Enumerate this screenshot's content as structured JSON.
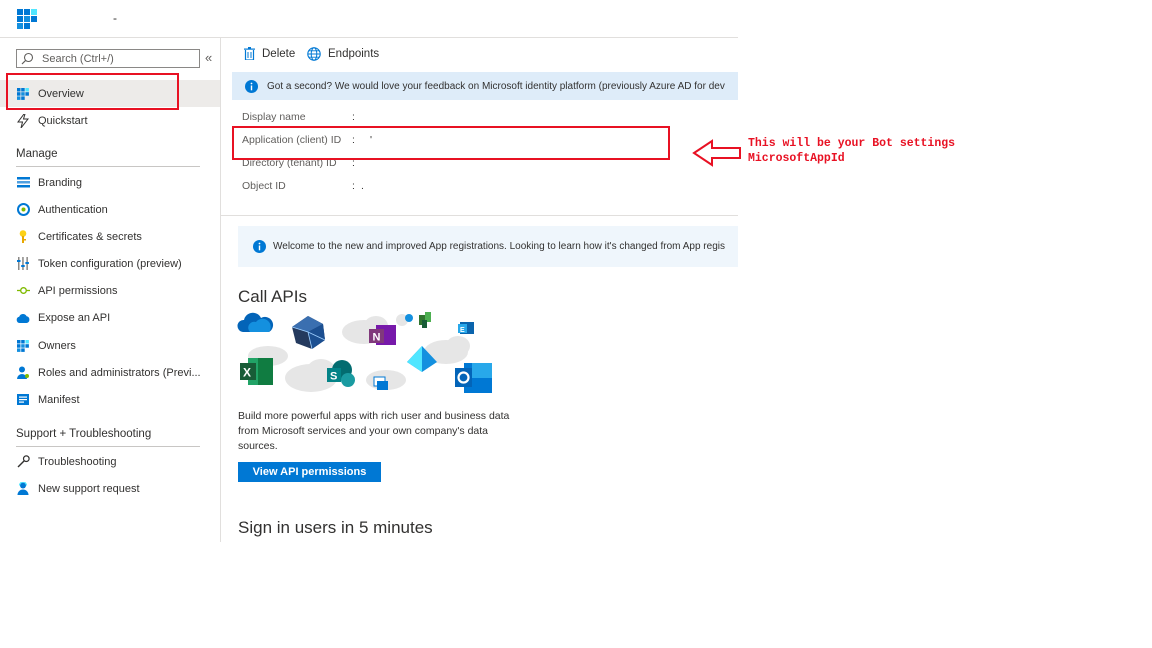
{
  "header": {
    "title_dash": "-"
  },
  "sidebar": {
    "search_placeholder": "Search (Ctrl+/)",
    "collapse_glyph": "«",
    "top_items": [
      {
        "label": "Overview",
        "icon": "overview-grid-icon",
        "active": true
      },
      {
        "label": "Quickstart",
        "icon": "quickstart-bolt-icon"
      }
    ],
    "manage_heading": "Manage",
    "manage_items": [
      {
        "label": "Branding",
        "icon": "branding-icon"
      },
      {
        "label": "Authentication",
        "icon": "authentication-icon"
      },
      {
        "label": "Certificates & secrets",
        "icon": "key-icon"
      },
      {
        "label": "Token configuration (preview)",
        "icon": "token-config-icon"
      },
      {
        "label": "API permissions",
        "icon": "api-permissions-icon"
      },
      {
        "label": "Expose an API",
        "icon": "cloud-icon"
      },
      {
        "label": "Owners",
        "icon": "owners-grid-icon"
      },
      {
        "label": "Roles and administrators (Previ...",
        "icon": "roles-person-icon"
      },
      {
        "label": "Manifest",
        "icon": "manifest-icon"
      }
    ],
    "support_heading": "Support + Troubleshooting",
    "support_items": [
      {
        "label": "Troubleshooting",
        "icon": "wrench-icon"
      },
      {
        "label": "New support request",
        "icon": "support-person-icon"
      }
    ]
  },
  "toolbar": {
    "delete_label": "Delete",
    "endpoints_label": "Endpoints"
  },
  "feedback": {
    "text": "Got a second? We would love your feedback on Microsoft identity platform (previously Azure AD for dev"
  },
  "properties": [
    {
      "label": "Display name",
      "colon": ":",
      "value": ""
    },
    {
      "label": "Application (client) ID",
      "colon": ":",
      "value": "'"
    },
    {
      "label": "Directory (tenant) ID",
      "colon": ":",
      "value": ""
    },
    {
      "label": "Object ID",
      "colon": ":",
      "value": "."
    }
  ],
  "welcome": {
    "text": "Welcome to the new and improved App registrations. Looking to learn how it's changed from App regis"
  },
  "call_apis": {
    "title": "Call APIs",
    "description": "Build more powerful apps with rich user and business data from Microsoft services and your own company's data sources.",
    "button_label": "View API permissions"
  },
  "signin": {
    "title": "Sign in users in 5 minutes"
  },
  "annotation": {
    "text": "This will be your Bot settings\nMicrosoftAppId",
    "color": "#e81123"
  },
  "colors": {
    "accent": "#0078d4",
    "info_bar": "#deecf9",
    "welcome_bar": "#eff6fc",
    "active_nav": "#edebe9"
  }
}
